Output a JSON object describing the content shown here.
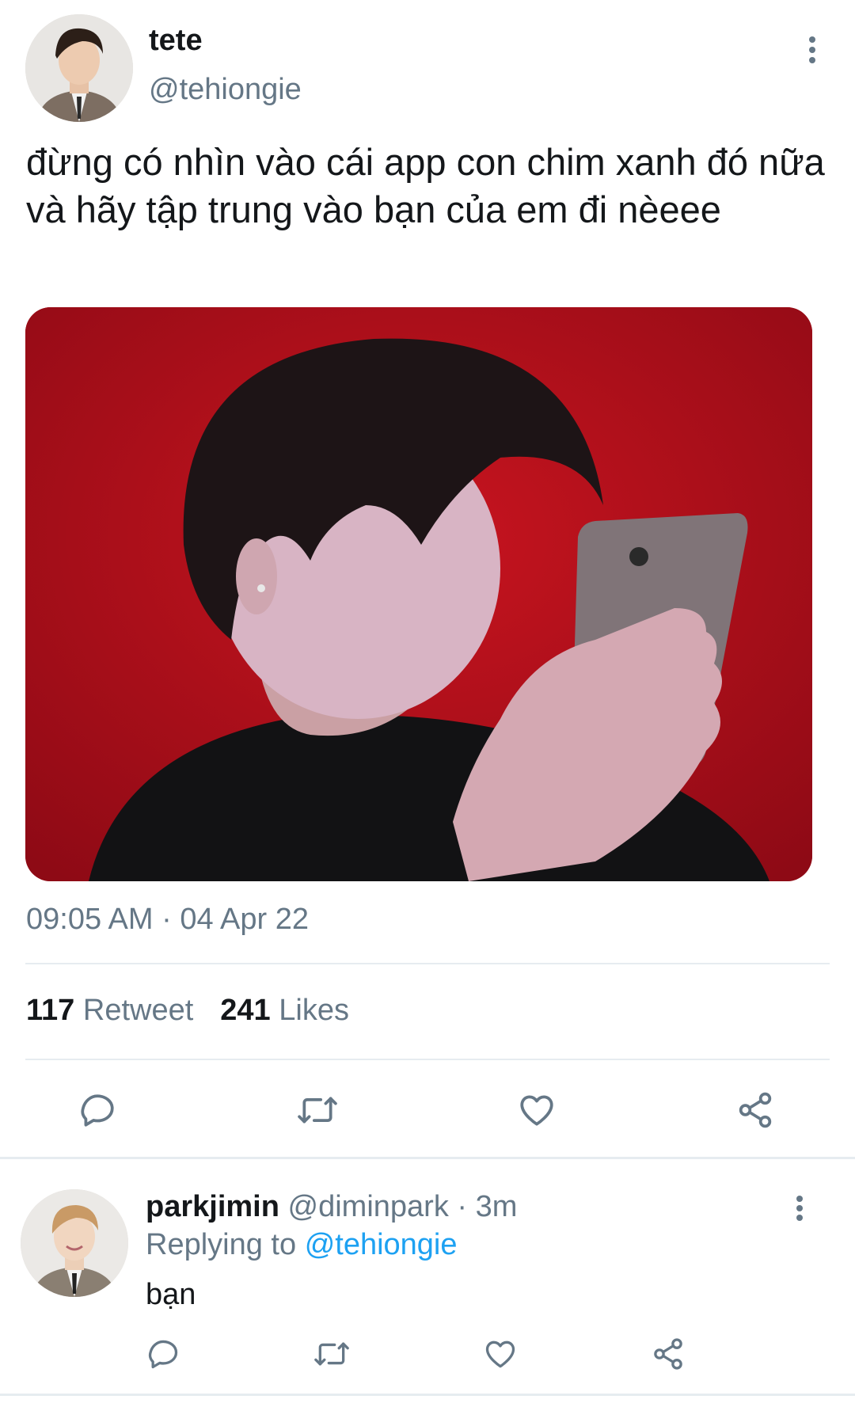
{
  "tweet": {
    "author": {
      "name": "tete",
      "handle": "@tehiongie"
    },
    "text": "đừng có nhìn vào cái app con chim xanh đó nữa và hãy tập trung vào bạn của em đi nèeee",
    "timestamp": "09:05 AM · 04 Apr 22",
    "stats": {
      "retweets_count": "117",
      "retweets_label": "Retweet",
      "likes_count": "241",
      "likes_label": "Likes"
    },
    "actions": [
      "reply-icon",
      "retweet-icon",
      "like-icon",
      "share-icon"
    ]
  },
  "reply": {
    "author": {
      "name": "parkjimin",
      "handle": "@diminpark",
      "time": "· 3m"
    },
    "replying_label": "Replying to",
    "replying_to": "@tehiongie",
    "text": "bạn",
    "actions": [
      "reply-icon",
      "retweet-icon",
      "like-icon",
      "share-icon"
    ]
  },
  "colors": {
    "text": "#14171a",
    "secondary": "#657786",
    "link": "#1da1f2",
    "divider": "#e6ecf0",
    "media_background": "#b0101c"
  }
}
